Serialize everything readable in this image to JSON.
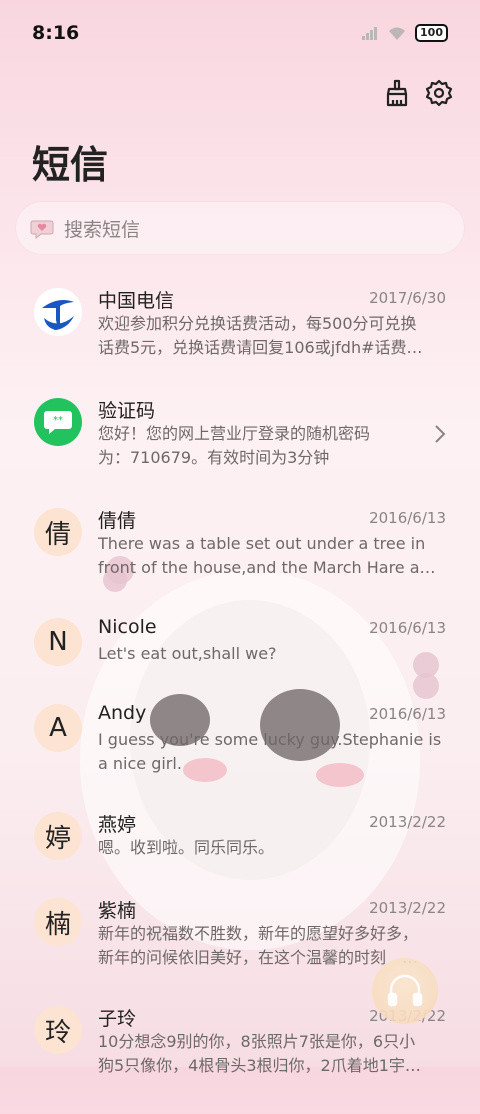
{
  "status": {
    "time": "8:16",
    "battery": "100"
  },
  "toolbar": {
    "clean_icon": "broom-icon",
    "settings_icon": "gear-icon"
  },
  "header": {
    "title": "短信"
  },
  "search": {
    "placeholder": "搜索短信",
    "icon": "heart-bubble-icon"
  },
  "chats": [
    {
      "name": "中国电信",
      "date": "2017/6/30",
      "avatar": "china-telecom-logo",
      "lines": [
        "欢迎参加积分兑换话费活动，每500分可兑换",
        "话费5元，兑换话费请回复106或jfdh#话费…"
      ]
    },
    {
      "name": "验证码",
      "date": "",
      "avatar": "message-bubble-icon",
      "lines": [
        "您好！您的网上营业厅登录的随机密码",
        "为：710679。有效时间为3分钟"
      ]
    },
    {
      "name": "倩倩",
      "date": "2016/6/13",
      "avatar_letter": "倩",
      "lines": [
        "There was a table set out under a tree in",
        "front of the house,and the March Hare an…"
      ]
    },
    {
      "name": "Nicole",
      "date": "2016/6/13",
      "avatar_letter": "N",
      "lines": [
        "Let's eat out,shall we?"
      ]
    },
    {
      "name": "Andy",
      "date": "2016/6/13",
      "avatar_letter": "A",
      "lines": [
        "I guess you're some lucky guy.Stephanie is",
        "a nice girl."
      ]
    },
    {
      "name": "燕婷",
      "date": "2013/2/22",
      "avatar_letter": "婷",
      "lines": [
        "嗯。收到啦。同乐同乐。"
      ]
    },
    {
      "name": "紫楠",
      "date": "2013/2/22",
      "avatar_letter": "楠",
      "lines": [
        "新年的祝福数不胜数，新年的愿望好多好多，",
        "新年的问候依旧美好，在这个温馨的时刻　…"
      ]
    },
    {
      "name": "子玲",
      "date": "2013/2/22",
      "avatar_letter": "玲",
      "lines": [
        "10分想念9别的你，8张照片7张是你，6只小",
        "狗5只像你，4根骨头3根归你，2爪着地1宇…"
      ]
    }
  ],
  "fab": {
    "icon": "headphones-icon"
  },
  "colors": {
    "accent_avatar_bg": "#fce3d2",
    "verify_green": "#22c35e",
    "telecom_blue": "#1a57c2"
  }
}
